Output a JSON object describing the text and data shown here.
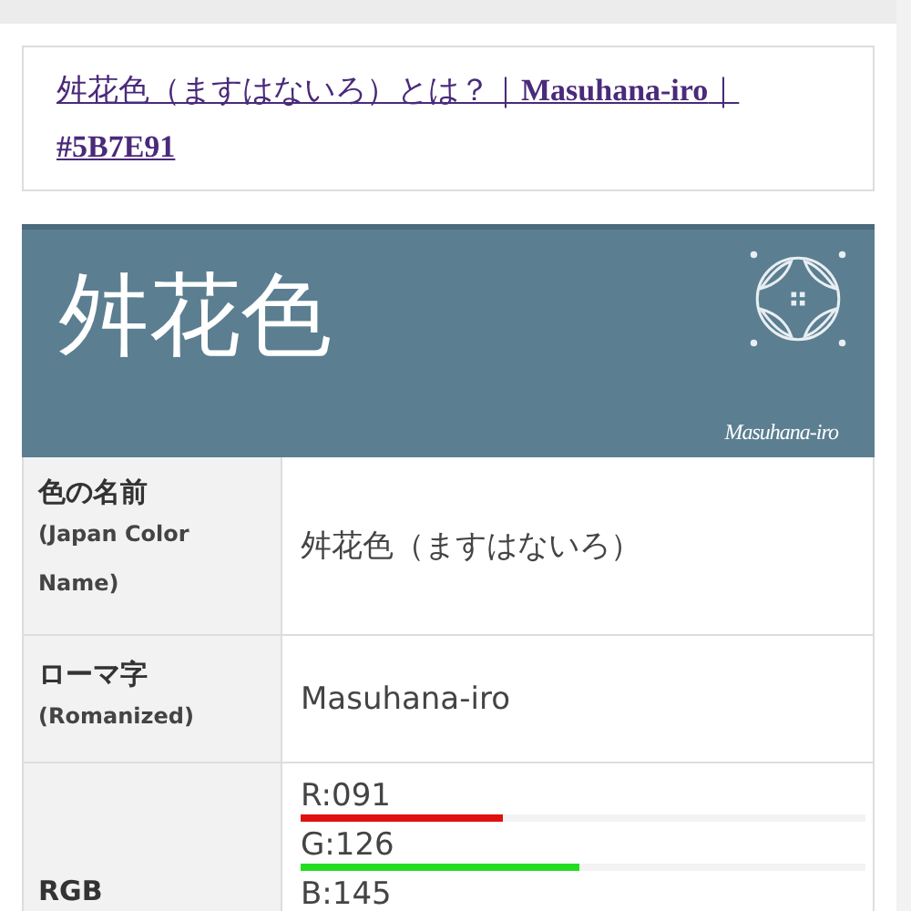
{
  "title_link": {
    "text": "舛花色（ますはないろ）とは？｜**Masuhana-iro**｜**#5B7E91**"
  },
  "banner": {
    "color": "#5b7e91",
    "kanji": "舛花色",
    "romaji": "Masuhana-iro"
  },
  "rows": [
    {
      "kind": "text",
      "label": "色の名前",
      "sublabel": "(Japan Color Name)",
      "value": "舛花色（ますはないろ）"
    },
    {
      "kind": "text",
      "label": "ローマ字",
      "sublabel": "(Romanized)",
      "value": "Masuhana-iro"
    },
    {
      "kind": "rgb",
      "label": "RGB",
      "channels": [
        {
          "text": "R:091",
          "level": 0.357,
          "color": "#e01010"
        },
        {
          "text": "G:126",
          "level": 0.494,
          "color": "#22dd22"
        },
        {
          "text": "B:145"
        }
      ]
    }
  ]
}
